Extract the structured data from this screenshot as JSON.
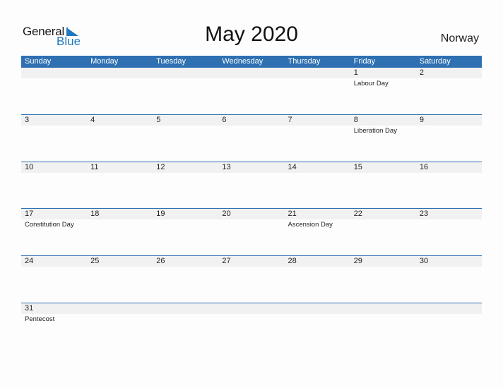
{
  "logo": {
    "line1": "General",
    "line2": "Blue"
  },
  "title": "May 2020",
  "country": "Norway",
  "colors": {
    "accent": "#2e70b1",
    "date_band": "#f1f1f1"
  },
  "weekdays": [
    "Sunday",
    "Monday",
    "Tuesday",
    "Wednesday",
    "Thursday",
    "Friday",
    "Saturday"
  ],
  "weeks": [
    [
      {
        "d": ""
      },
      {
        "d": ""
      },
      {
        "d": ""
      },
      {
        "d": ""
      },
      {
        "d": ""
      },
      {
        "d": "1",
        "h": "Labour Day"
      },
      {
        "d": "2"
      }
    ],
    [
      {
        "d": "3"
      },
      {
        "d": "4"
      },
      {
        "d": "5"
      },
      {
        "d": "6"
      },
      {
        "d": "7"
      },
      {
        "d": "8",
        "h": "Liberation Day"
      },
      {
        "d": "9"
      }
    ],
    [
      {
        "d": "10"
      },
      {
        "d": "11"
      },
      {
        "d": "12"
      },
      {
        "d": "13"
      },
      {
        "d": "14"
      },
      {
        "d": "15"
      },
      {
        "d": "16"
      }
    ],
    [
      {
        "d": "17",
        "h": "Constitution Day"
      },
      {
        "d": "18"
      },
      {
        "d": "19"
      },
      {
        "d": "20"
      },
      {
        "d": "21",
        "h": "Ascension Day"
      },
      {
        "d": "22"
      },
      {
        "d": "23"
      }
    ],
    [
      {
        "d": "24"
      },
      {
        "d": "25"
      },
      {
        "d": "26"
      },
      {
        "d": "27"
      },
      {
        "d": "28"
      },
      {
        "d": "29"
      },
      {
        "d": "30"
      }
    ],
    [
      {
        "d": "31",
        "h": "Pentecost"
      },
      {
        "d": ""
      },
      {
        "d": ""
      },
      {
        "d": ""
      },
      {
        "d": ""
      },
      {
        "d": ""
      },
      {
        "d": ""
      }
    ]
  ]
}
